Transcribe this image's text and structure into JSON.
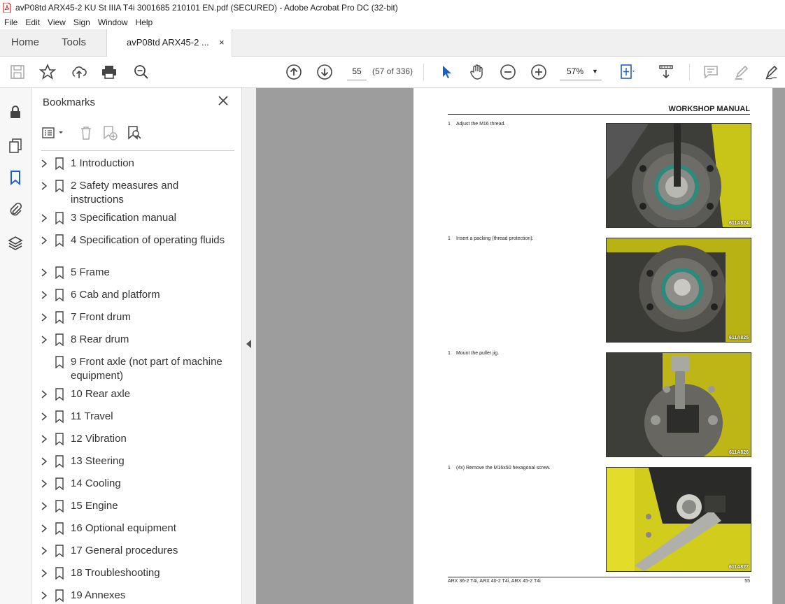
{
  "window": {
    "title": "avP08td ARX45-2 KU St IIIA T4i 3001685 210101 EN.pdf (SECURED) - Adobe Acrobat Pro DC (32-bit)"
  },
  "menu": [
    "File",
    "Edit",
    "View",
    "Sign",
    "Window",
    "Help"
  ],
  "tabs": {
    "home": "Home",
    "tools": "Tools",
    "document": "avP08td ARX45-2 ...",
    "close": "×"
  },
  "toolbar": {
    "page_number": "55",
    "page_count": "(57 of 336)",
    "zoom": "57%"
  },
  "bookmarks_panel": {
    "title": "Bookmarks",
    "items": [
      {
        "label": "1 Introduction",
        "expandable": true
      },
      {
        "label": "2 Safety measures and instructions",
        "expandable": true
      },
      {
        "label": "3 Specification manual",
        "expandable": true
      },
      {
        "label": "4 Specification of operating fluids",
        "expandable": true
      },
      {
        "label": "5 Frame",
        "expandable": true
      },
      {
        "label": "6 Cab and platform",
        "expandable": true
      },
      {
        "label": "7 Front drum",
        "expandable": true
      },
      {
        "label": "8 Rear drum",
        "expandable": true
      },
      {
        "label": "9 Front axle (not part of machine equipment)",
        "expandable": false
      },
      {
        "label": "10 Rear axle",
        "expandable": true
      },
      {
        "label": "11 Travel",
        "expandable": true
      },
      {
        "label": "12 Vibration",
        "expandable": true
      },
      {
        "label": "13 Steering",
        "expandable": true
      },
      {
        "label": "14 Cooling",
        "expandable": true
      },
      {
        "label": "15 Engine",
        "expandable": true
      },
      {
        "label": "16 Optional equipment",
        "expandable": true
      },
      {
        "label": "17 General procedures",
        "expandable": true
      },
      {
        "label": "18 Troubleshooting",
        "expandable": true
      },
      {
        "label": "19 Annexes",
        "expandable": true
      }
    ]
  },
  "document": {
    "header": "WORKSHOP MANUAL",
    "steps": [
      {
        "num": "1",
        "text": "Adjust the M16 thread.",
        "figure": "611A824"
      },
      {
        "num": "1",
        "text": "Insert a packing (thread protection).",
        "figure": "611A825"
      },
      {
        "num": "1",
        "text": "Mount the puller jig.",
        "figure": "611A826"
      },
      {
        "num": "1",
        "text": "(4x) Remove the M16x50 hexagonal screw.",
        "figure": "611A827"
      }
    ],
    "footer_left": "ARX 36-2 T4i, ARX 40-2 T4i, ARX 45-2 T4i",
    "footer_right": "55"
  }
}
